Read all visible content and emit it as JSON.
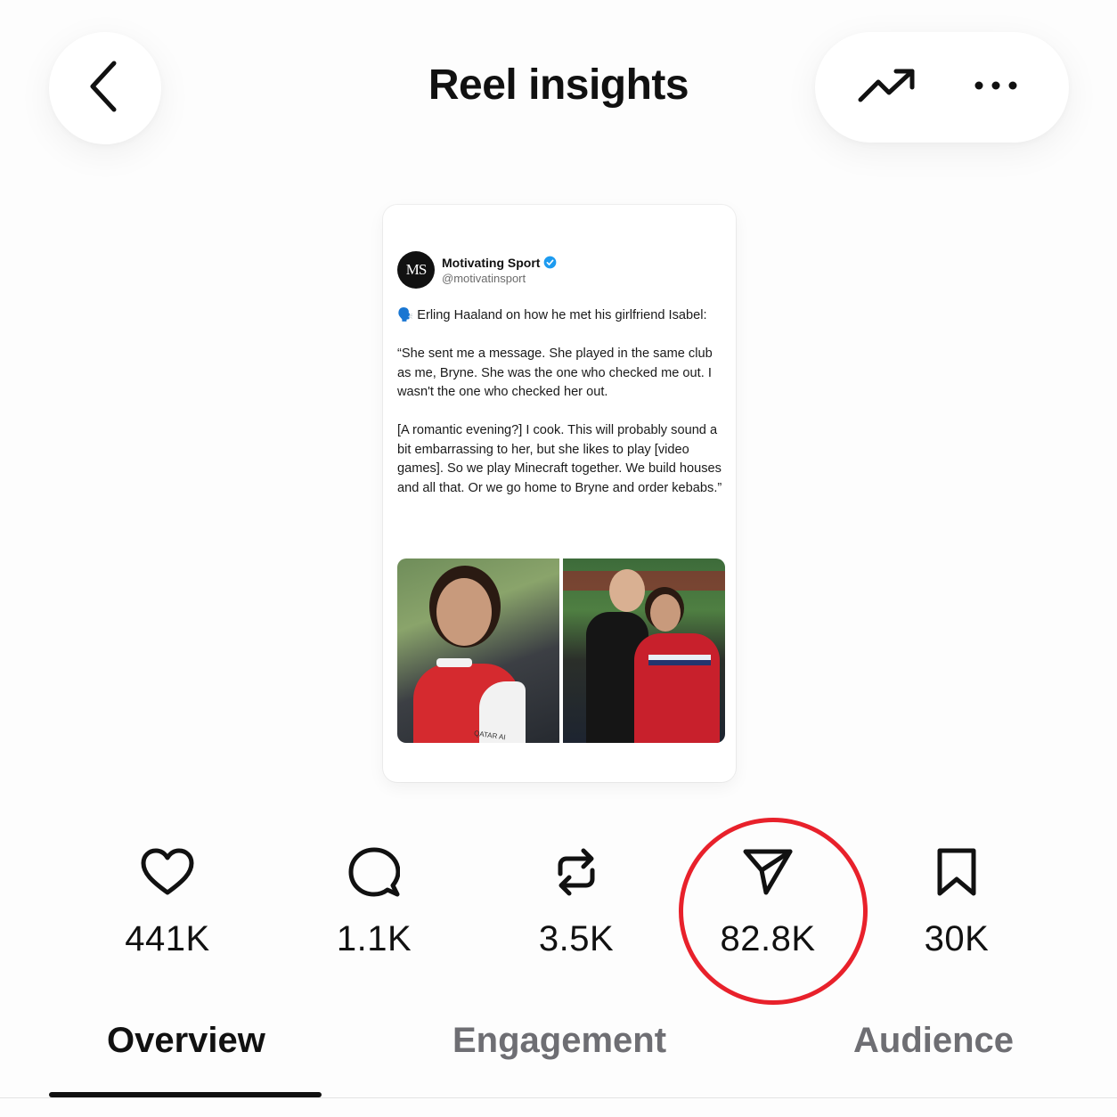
{
  "header": {
    "title": "Reel insights",
    "back_icon": "chevron-left-icon",
    "trend_icon": "trending-up-icon",
    "more_icon": "ellipsis-icon"
  },
  "preview": {
    "account_name": "Motivating Sport",
    "account_handle": "@motivatinsport",
    "avatar_text": "MS",
    "verified": true,
    "verified_color": "#1d9bf0",
    "text": "🗣️ Erling Haaland on how he met his girlfriend Isabel:\n\n“She sent me a message. She played in the same club as me, Bryne. She was the one who checked me out. I wasn't the one who checked her out.\n\n[A romantic evening?] I cook. This will probably sound a bit embarrassing to her, but she likes to play [video games]. So we play Minecraft together. We build houses and all that. Or we go home to Bryne and order kebabs.”",
    "photo_caption_left": "QATAR AI"
  },
  "stats": [
    {
      "name": "likes",
      "icon": "heart-icon",
      "value": "441K"
    },
    {
      "name": "comments",
      "icon": "comment-icon",
      "value": "1.1K"
    },
    {
      "name": "reposts",
      "icon": "repost-icon",
      "value": "3.5K"
    },
    {
      "name": "shares",
      "icon": "send-icon",
      "value": "82.8K",
      "highlighted": true
    },
    {
      "name": "saves",
      "icon": "bookmark-icon",
      "value": "30K"
    }
  ],
  "highlight_color": "#e8212b",
  "tabs": [
    {
      "label": "Overview",
      "active": true
    },
    {
      "label": "Engagement",
      "active": false
    },
    {
      "label": "Audience",
      "active": false
    }
  ]
}
